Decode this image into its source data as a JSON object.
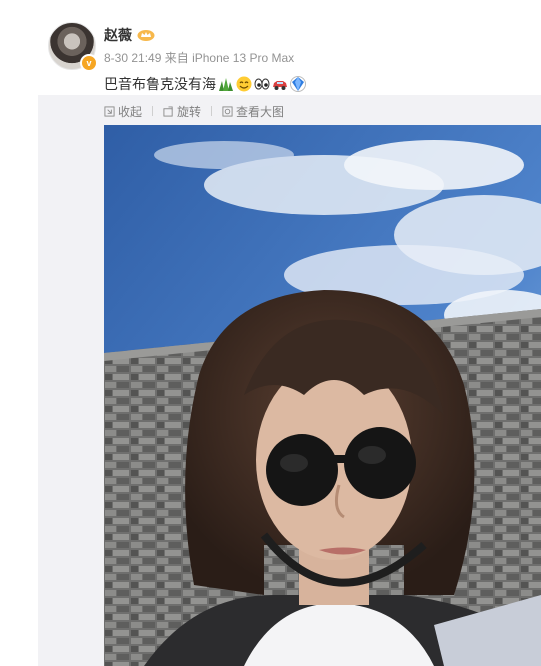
{
  "post": {
    "username": "赵薇",
    "timestamp": "8-30 21:49",
    "source": "来自 iPhone 13 Pro Max",
    "text": "巴音布鲁克没有海",
    "emojis": [
      "grass-emoji",
      "grin-emoji",
      "eyes-emoji",
      "car-emoji",
      "sapphire-emoji"
    ]
  },
  "toolbar": {
    "collapse_label": "收起",
    "rotate_label": "旋转",
    "view_large_label": "查看大图"
  },
  "colors": {
    "meta_text": "#939393",
    "toolbar_text": "#808080",
    "panel_bg": "#f2f2f5",
    "sky": "#4f7fc6",
    "wall": "#7b7b7a"
  },
  "icons": {
    "vip_badge": "v-badge-icon",
    "member": "crown-icon"
  }
}
